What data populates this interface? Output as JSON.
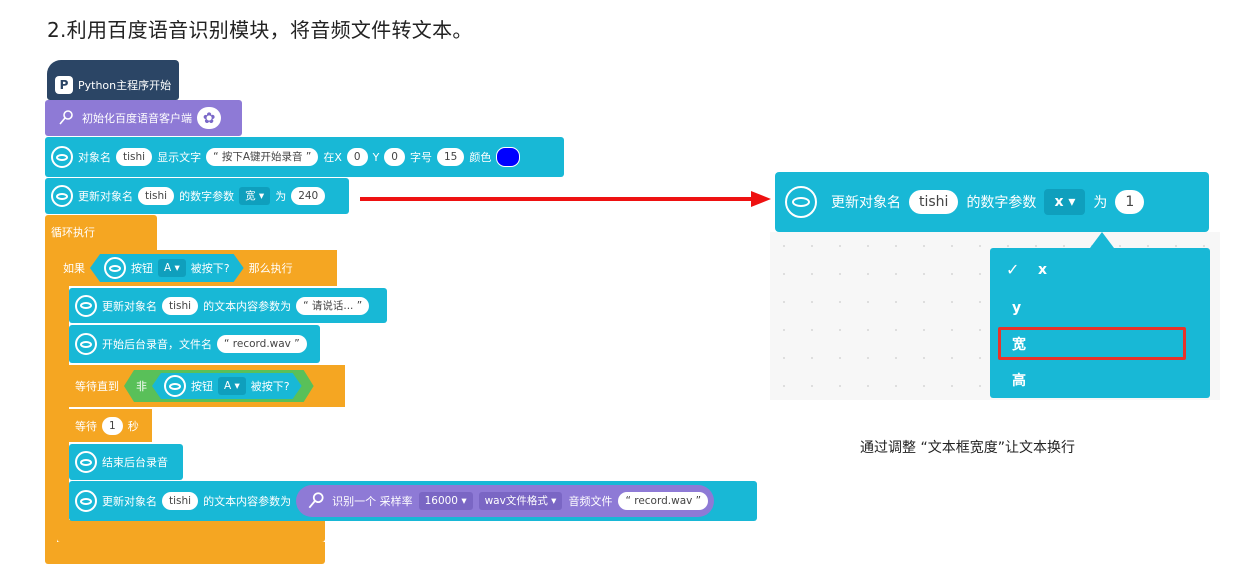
{
  "heading": "2.利用百度语音识别模块，将音频文件转文本。",
  "caption": "通过调整 “文本框宽度”让文本换行",
  "colors": {
    "cyan": "#18b8d6",
    "orange": "#f5a622",
    "purple": "#8e7ad6",
    "navy": "#2b4565",
    "green": "#59c059",
    "arrow": "#ee1111",
    "highlight": "#e8332a"
  },
  "icons": {
    "python": "python-logo-icon",
    "mic": "microphone-icon",
    "object": "object-ellipse-icon",
    "settings": "gear-icon"
  },
  "blocks": {
    "start": {
      "label": "Python主程序开始"
    },
    "init": {
      "label": "初始化百度语音客户端"
    },
    "show": {
      "label1": "对象名",
      "name": "tishi",
      "label2": "显示文字",
      "text": "“ 按下A键开始录音 ”",
      "x_label": "在X",
      "x": "0",
      "y_label": "Y",
      "y": "0",
      "size_label": "字号",
      "size": "15",
      "color_label": "颜色"
    },
    "update1": {
      "label1": "更新对象名",
      "name": "tishi",
      "label2": "的数字参数",
      "param": "宽 ▾",
      "label3": "为",
      "value": "240"
    },
    "loop": {
      "label": "循环执行"
    },
    "if": {
      "label": "如果",
      "button_label": "按钮",
      "button": "A ▾",
      "pressed": "被按下?",
      "then": "那么执行"
    },
    "update_text": {
      "label1": "更新对象名",
      "name": "tishi",
      "label2": "的文本内容参数为",
      "text": "“ 请说话... ”"
    },
    "record": {
      "label": "开始后台录音，文件名",
      "file": "“ record.wav ”"
    },
    "wait_until": {
      "label": "等待直到",
      "not": "非",
      "button_label": "按钮",
      "button": "A ▾",
      "pressed": "被按下?"
    },
    "wait": {
      "label": "等待",
      "value": "1",
      "unit": "秒"
    },
    "stop": {
      "label": "结束后台录音"
    },
    "update_result": {
      "label1": "更新对象名",
      "name": "tishi",
      "label2": "的文本内容参数为",
      "recog": "识别一个 采样率",
      "rate": "16000 ▾",
      "format": "wav文件格式 ▾",
      "file_label": "音频文件",
      "file": "“ record.wav ”"
    }
  },
  "zoom": {
    "label1": "更新对象名",
    "name": "tishi",
    "label2": "的数字参数",
    "param": "x ▾",
    "label3": "为",
    "value": "1"
  },
  "menu": {
    "check": "✓",
    "items": [
      "x",
      "y",
      "宽",
      "高"
    ]
  }
}
